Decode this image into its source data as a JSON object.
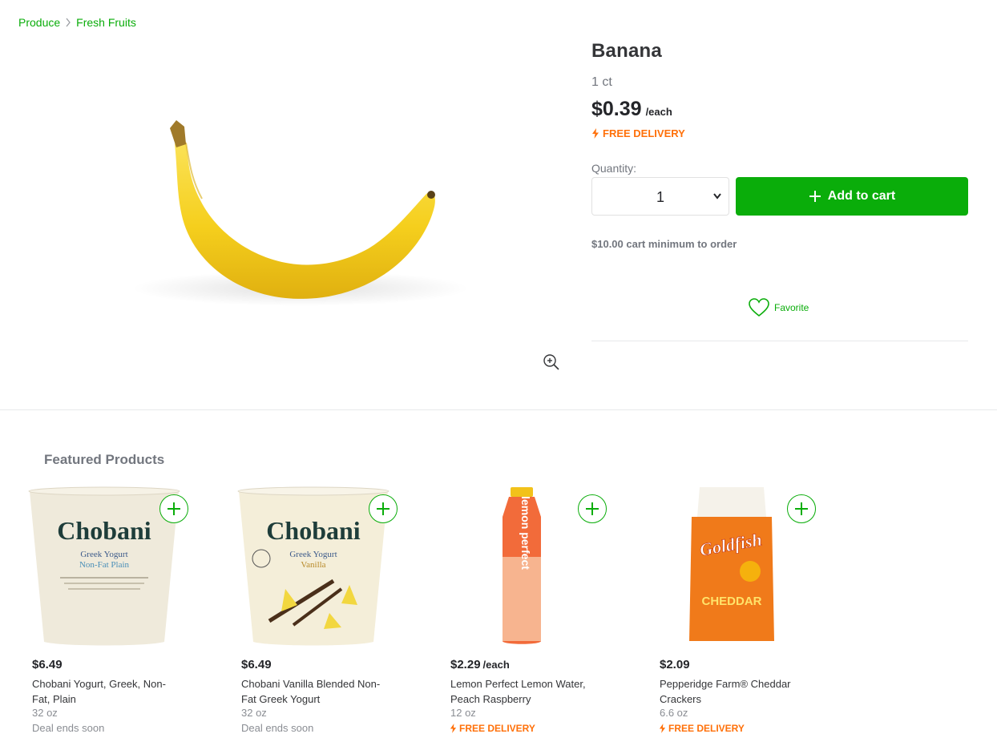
{
  "breadcrumb": {
    "items": [
      "Produce",
      "Fresh Fruits"
    ]
  },
  "product": {
    "title": "Banana",
    "size": "1 ct",
    "price": "$0.39",
    "price_unit": "/each",
    "free_delivery": "FREE DELIVERY",
    "quantity_label": "Quantity:",
    "quantity_value": "1",
    "add_to_cart": "Add to cart",
    "min_order": "$10.00 cart minimum to order",
    "favorite": "Favorite"
  },
  "featured": {
    "title": "Featured Products",
    "items": [
      {
        "price": "$6.49",
        "unit": "",
        "name": "Chobani Yogurt, Greek, Non-Fat, Plain",
        "size": "32 oz",
        "note": "Deal ends soon",
        "brand_text": "Chobani",
        "sub_text": "Greek Yogurt",
        "flavor_text": "Non-Fat Plain"
      },
      {
        "price": "$6.49",
        "unit": "",
        "name": "Chobani Vanilla Blended Non-Fat Greek Yogurt",
        "size": "32 oz",
        "note": "Deal ends soon",
        "brand_text": "Chobani",
        "sub_text": "Greek Yogurt",
        "flavor_text": "Vanilla"
      },
      {
        "price": "$2.29",
        "unit": "/each",
        "name": "Lemon Perfect Lemon Water, Peach Raspberry",
        "size": "12 oz",
        "delivery": "FREE DELIVERY",
        "brand_text": "lemon perfect"
      },
      {
        "price": "$2.09",
        "unit": "",
        "name": "Pepperidge Farm® Cheddar Crackers",
        "size": "6.6 oz",
        "delivery": "FREE DELIVERY",
        "brand_text": "Goldfish",
        "flavor_text": "CHEDDAR"
      }
    ]
  },
  "colors": {
    "accent": "#0aad0a",
    "delivery": "#ff7009",
    "text": "#343538",
    "muted": "#72767e"
  }
}
